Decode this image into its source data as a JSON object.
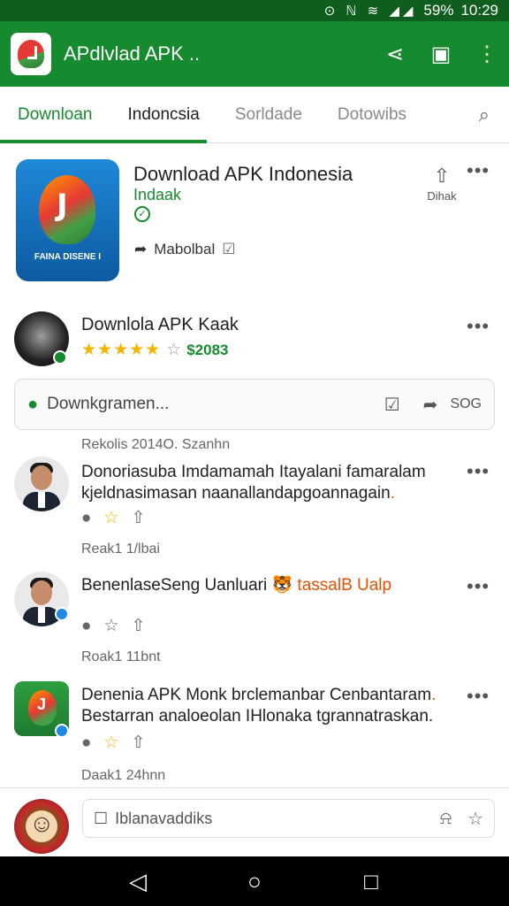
{
  "status_bar": {
    "icons": "⊙ ℕ ≋ ◢◢",
    "battery": "59%",
    "time": "10:29"
  },
  "app_bar": {
    "title": "APdlvlad APK ..",
    "actions": [
      "share-icon",
      "bookmark-icon",
      "more-vert-icon"
    ]
  },
  "tabs": [
    "Downloan",
    "Indoncsia",
    "Sorldade",
    "Dotowibs"
  ],
  "app_card": {
    "title": "Download APK Indonesia",
    "developer": "Indaak",
    "icon_caption": "FAINA DISENE I",
    "tag": "Mabolbal",
    "share_label": "Dihak"
  },
  "review_header": {
    "name": "Downlola APK Kaak",
    "stars": "★★★★★",
    "empty_star": "☆",
    "count": "$2083"
  },
  "search": {
    "placeholder": "Downkgramen...",
    "count": "SOG"
  },
  "meta_top": "Rekolis 2014O. Szanhn",
  "comments": [
    {
      "line1": "Donoriasuba  Imdamamah Itayalani  famaralam",
      "line2": "kjeldnasimasan naanallandapgoannagain",
      "line2_accent": ".",
      "meta": "Reak1   1/lbai"
    },
    {
      "line1": "BenenlaseSeng Uanluari",
      "line1_accent": "🐯 tassalB Ualp",
      "meta": "Roak1   11bnt"
    },
    {
      "line1": "Denenia APK Monk brclemanbar Cenbantaram",
      "line1_accent": ".",
      "line2": "Bestarran analoeolan IHlonaka tgrannatraskan.",
      "meta": "Daak1   24hnn"
    }
  ],
  "bottom_input": {
    "placeholder": "Iblanavaddiks"
  },
  "colors": {
    "brand_green": "#168a2e",
    "status_green": "#0f5e1e",
    "star": "#f5b400",
    "accent_orange": "#e65100"
  }
}
